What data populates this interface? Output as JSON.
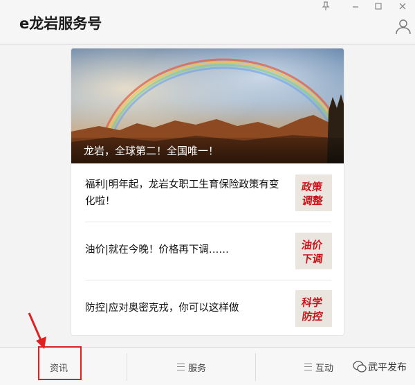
{
  "app": {
    "title": "e龙岩服务号"
  },
  "window_controls": [
    "pin-icon",
    "minimize-icon",
    "maximize-icon",
    "close-icon"
  ],
  "hero": {
    "caption": "龙岩，全球第二！全国唯一！"
  },
  "articles": [
    {
      "title": "福利|明年起，龙岩女职工生育保险政策有变化啦！",
      "thumb_text": [
        "政策",
        "调整"
      ]
    },
    {
      "title": "油价|就在今晚！价格再下调……",
      "thumb_text": [
        "油价",
        "下调"
      ]
    },
    {
      "title": "防控|应对奥密克戎，你可以这样做",
      "thumb_text": [
        "科学",
        "防控"
      ]
    }
  ],
  "menu": [
    {
      "label": "资讯",
      "icon": ""
    },
    {
      "label": "服务",
      "icon": "menu-icon"
    },
    {
      "label": "互动",
      "icon": "menu-icon"
    }
  ],
  "watermark": {
    "text": "武平发布"
  },
  "colors": {
    "annotation_red": "#e02020",
    "thumb_red": "#c8151b"
  }
}
